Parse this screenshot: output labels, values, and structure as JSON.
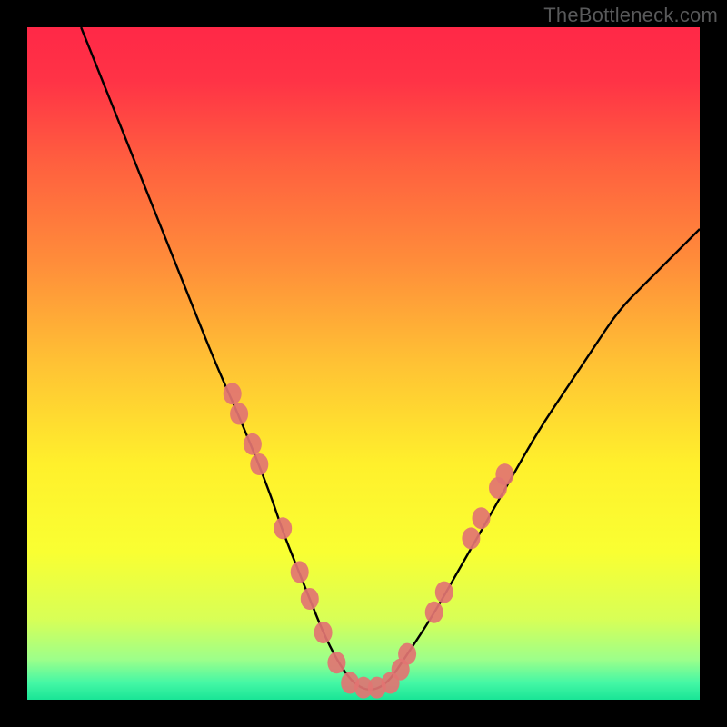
{
  "watermark": "TheBottleneck.com",
  "chart_data": {
    "type": "line",
    "title": "",
    "xlabel": "",
    "ylabel": "",
    "x_range": [
      0,
      100
    ],
    "y_range": [
      0,
      100
    ],
    "curve": {
      "name": "bottleneck-curve",
      "color": "#000000",
      "x": [
        8,
        12,
        16,
        20,
        24,
        28,
        32,
        36,
        38,
        40,
        42,
        44,
        46,
        48,
        50,
        52,
        54,
        56,
        60,
        64,
        68,
        72,
        76,
        80,
        84,
        88,
        92,
        96,
        100
      ],
      "y": [
        100,
        90,
        80,
        70,
        60,
        50,
        41,
        31,
        25,
        20,
        15,
        10,
        6,
        3,
        1.5,
        1.5,
        3,
        6,
        12,
        19,
        26,
        33,
        40,
        46,
        52,
        58,
        62,
        66,
        70
      ]
    },
    "markers": {
      "name": "points",
      "color": "#e27472",
      "points": [
        {
          "x": 30.5,
          "y": 45.5
        },
        {
          "x": 31.5,
          "y": 42.5
        },
        {
          "x": 33.5,
          "y": 38
        },
        {
          "x": 34.5,
          "y": 35
        },
        {
          "x": 38,
          "y": 25.5
        },
        {
          "x": 40.5,
          "y": 19
        },
        {
          "x": 42,
          "y": 15
        },
        {
          "x": 44,
          "y": 10
        },
        {
          "x": 46,
          "y": 5.5
        },
        {
          "x": 48,
          "y": 2.5
        },
        {
          "x": 50,
          "y": 1.8
        },
        {
          "x": 52,
          "y": 1.8
        },
        {
          "x": 54,
          "y": 2.5
        },
        {
          "x": 55.5,
          "y": 4.5
        },
        {
          "x": 56.5,
          "y": 6.8
        },
        {
          "x": 60.5,
          "y": 13
        },
        {
          "x": 62,
          "y": 16
        },
        {
          "x": 66,
          "y": 24
        },
        {
          "x": 67.5,
          "y": 27
        },
        {
          "x": 70,
          "y": 31.5
        },
        {
          "x": 71,
          "y": 33.5
        }
      ]
    },
    "gradient_stops": [
      {
        "offset": 0,
        "color": "#ff2847"
      },
      {
        "offset": 0.08,
        "color": "#ff3346"
      },
      {
        "offset": 0.2,
        "color": "#ff5f3f"
      },
      {
        "offset": 0.35,
        "color": "#ff8d3a"
      },
      {
        "offset": 0.5,
        "color": "#ffc234"
      },
      {
        "offset": 0.65,
        "color": "#fff02c"
      },
      {
        "offset": 0.78,
        "color": "#f9ff32"
      },
      {
        "offset": 0.88,
        "color": "#d8ff56"
      },
      {
        "offset": 0.94,
        "color": "#9dff8a"
      },
      {
        "offset": 0.975,
        "color": "#44f7a5"
      },
      {
        "offset": 1.0,
        "color": "#19e596"
      }
    ]
  }
}
